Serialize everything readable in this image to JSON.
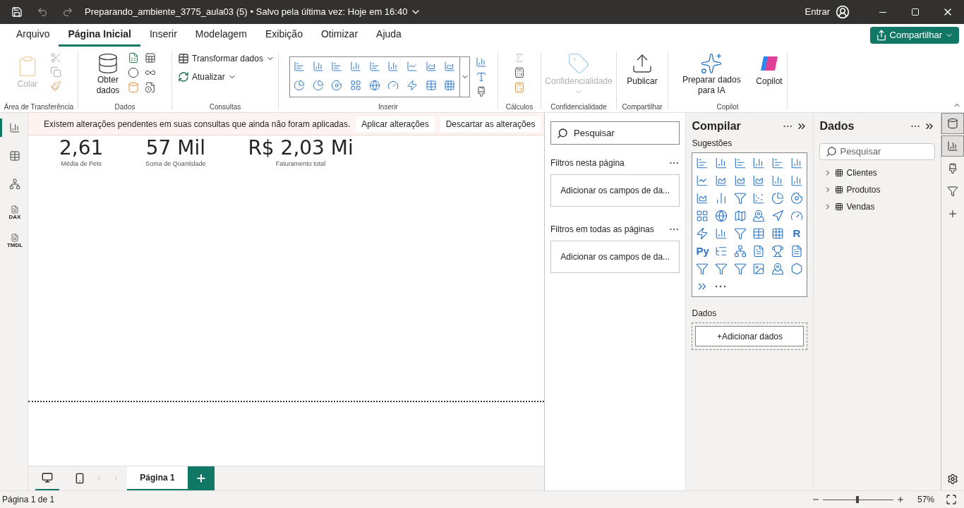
{
  "title_bar": {
    "file_title": "Preparando_ambiente_3775_aula03 (5)",
    "saved_status": "• Salvo pela última vez: Hoje em 16:40",
    "sign_in": "Entrar"
  },
  "menu_tabs": [
    {
      "label": "Arquivo",
      "selected": false
    },
    {
      "label": "Página Inicial",
      "selected": true
    },
    {
      "label": "Inserir",
      "selected": false
    },
    {
      "label": "Modelagem",
      "selected": false
    },
    {
      "label": "Exibição",
      "selected": false
    },
    {
      "label": "Otimizar",
      "selected": false
    },
    {
      "label": "Ajuda",
      "selected": false
    }
  ],
  "share_button": "Compartilhar",
  "ribbon": {
    "paste": {
      "label": "Colar",
      "disabled": true
    },
    "clipboard_group": "Área de Transferência",
    "get_data": "Obter dados",
    "data_group": "Dados",
    "transform": "Transformar dados",
    "refresh": "Atualizar",
    "queries_group": "Consultas",
    "insert_group": "Inserir",
    "calc_group": "Cálculos",
    "sensitivity": {
      "label": "Confidencialidade",
      "disabled": true
    },
    "sensitivity_group": "Confidencialidade",
    "publish": "Publicar",
    "share_group": "Compartilhar",
    "prepare_ai": "Preparar dados para IA",
    "copilot": "Copilot",
    "copilot_group": "Copilot"
  },
  "banner": {
    "message": "Existem alterações pendentes em suas consultas que ainda não foram aplicadas.",
    "actions": [
      "Aplicar alterações",
      "Descartar as alterações"
    ]
  },
  "cards": [
    {
      "value": "2,61",
      "label": "Média de Pets"
    },
    {
      "value": "57 Mil",
      "label": "Soma de Quantidade"
    },
    {
      "value": "R$ 2,03 Mi",
      "label": "Faturamento total"
    }
  ],
  "views": [
    {
      "selected": true
    },
    {
      "selected": false
    },
    {
      "selected": false
    },
    {
      "selected": false,
      "label": "DAX"
    },
    {
      "selected": false,
      "label": "TMDL"
    }
  ],
  "filters": {
    "search_placeholder": "Pesquisar",
    "sections": [
      {
        "title": "Filtros nesta página",
        "drop_text": "Adicionar os campos de da..."
      },
      {
        "title": "Filtros em todas as páginas",
        "drop_text": "Adicionar os campos de da..."
      }
    ]
  },
  "build_pane": {
    "title": "Compilar",
    "suggestions_label": "Sugestões",
    "text_visuals": [
      "R",
      "Py"
    ],
    "data_label": "Dados",
    "add_button": "+Adicionar dados"
  },
  "data_pane": {
    "title": "Dados",
    "search_placeholder": "Pesquisar",
    "tables": [
      {
        "name": "Clientes",
        "expanded": false
      },
      {
        "name": "Produtos",
        "expanded": false
      },
      {
        "name": "Vendas",
        "expanded": false
      }
    ]
  },
  "rail": [
    {
      "selected": true
    },
    {
      "selected": true
    },
    {
      "selected": false
    },
    {
      "selected": false
    },
    {
      "selected": false
    }
  ],
  "page_tabs": [
    {
      "label": "Página 1",
      "selected": true
    }
  ],
  "status": {
    "page_info": "Página 1 de 1",
    "zoom": "57%",
    "level": 0.49
  }
}
